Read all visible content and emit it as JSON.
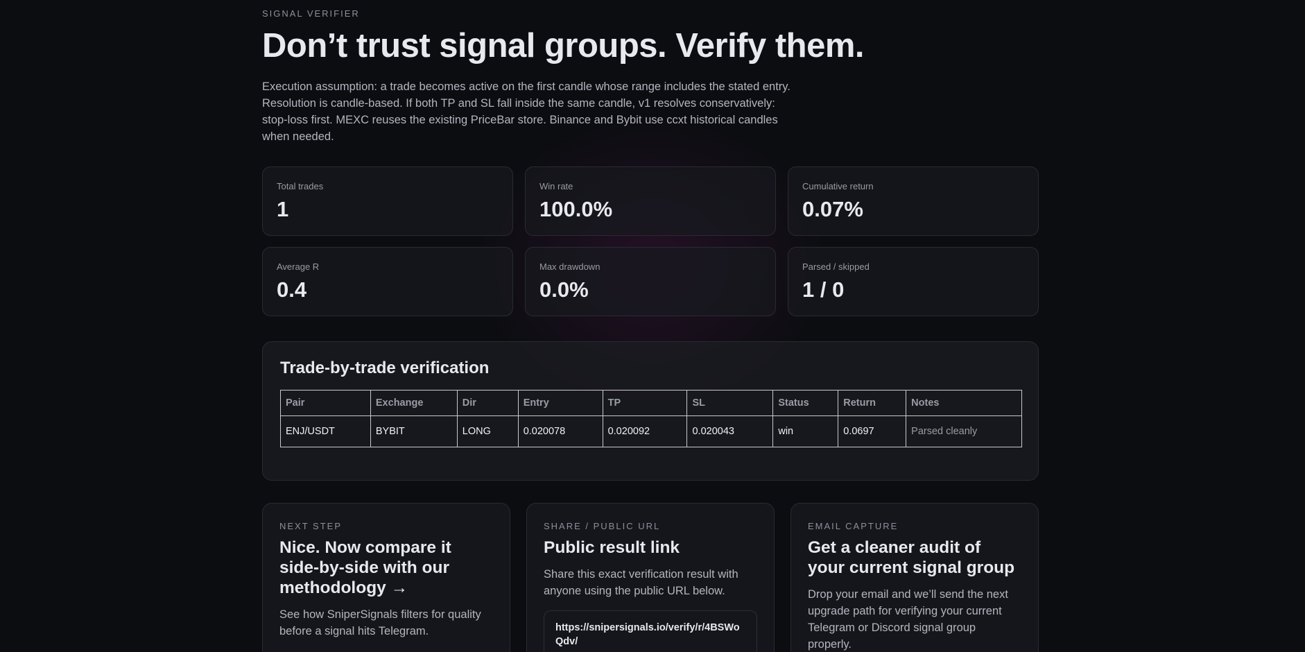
{
  "header": {
    "eyebrow": "SIGNAL VERIFIER",
    "title": "Don’t trust signal groups. Verify them.",
    "description": "Execution assumption: a trade becomes active on the first candle whose range includes the stated entry. Resolution is candle-based. If both TP and SL fall inside the same candle, v1 resolves conservatively: stop-loss first. MEXC reuses the existing PriceBar store. Binance and Bybit use ccxt historical candles when needed."
  },
  "stats": [
    {
      "label": "Total trades",
      "value": "1"
    },
    {
      "label": "Win rate",
      "value": "100.0%"
    },
    {
      "label": "Cumulative return",
      "value": "0.07%"
    },
    {
      "label": "Average R",
      "value": "0.4"
    },
    {
      "label": "Max drawdown",
      "value": "0.0%"
    },
    {
      "label": "Parsed / skipped",
      "value": "1 / 0"
    }
  ],
  "verification": {
    "title": "Trade-by-trade verification",
    "columns": [
      "Pair",
      "Exchange",
      "Dir",
      "Entry",
      "TP",
      "SL",
      "Status",
      "Return",
      "Notes"
    ],
    "rows": [
      [
        "ENJ/USDT",
        "BYBIT",
        "LONG",
        "0.020078",
        "0.020092",
        "0.020043",
        "win",
        "0.0697",
        "Parsed cleanly"
      ]
    ]
  },
  "cards": {
    "next_step": {
      "eyebrow": "NEXT STEP",
      "title": "Nice. Now compare it side-by-side with our methodology",
      "arrow": "→",
      "text": "See how SniperSignals filters for quality before a signal hits Telegram."
    },
    "share": {
      "eyebrow": "SHARE / PUBLIC URL",
      "title": "Public result link",
      "text": "Share this exact verification result with anyone using the public URL below.",
      "url": "https://snipersignals.io/verify/r/4BSWoQdv/"
    },
    "email": {
      "eyebrow": "EMAIL CAPTURE",
      "title": "Get a cleaner audit of your current signal group",
      "text": "Drop your email and we’ll send the next upgrade path for verifying your current Telegram or Discord signal group properly."
    }
  }
}
